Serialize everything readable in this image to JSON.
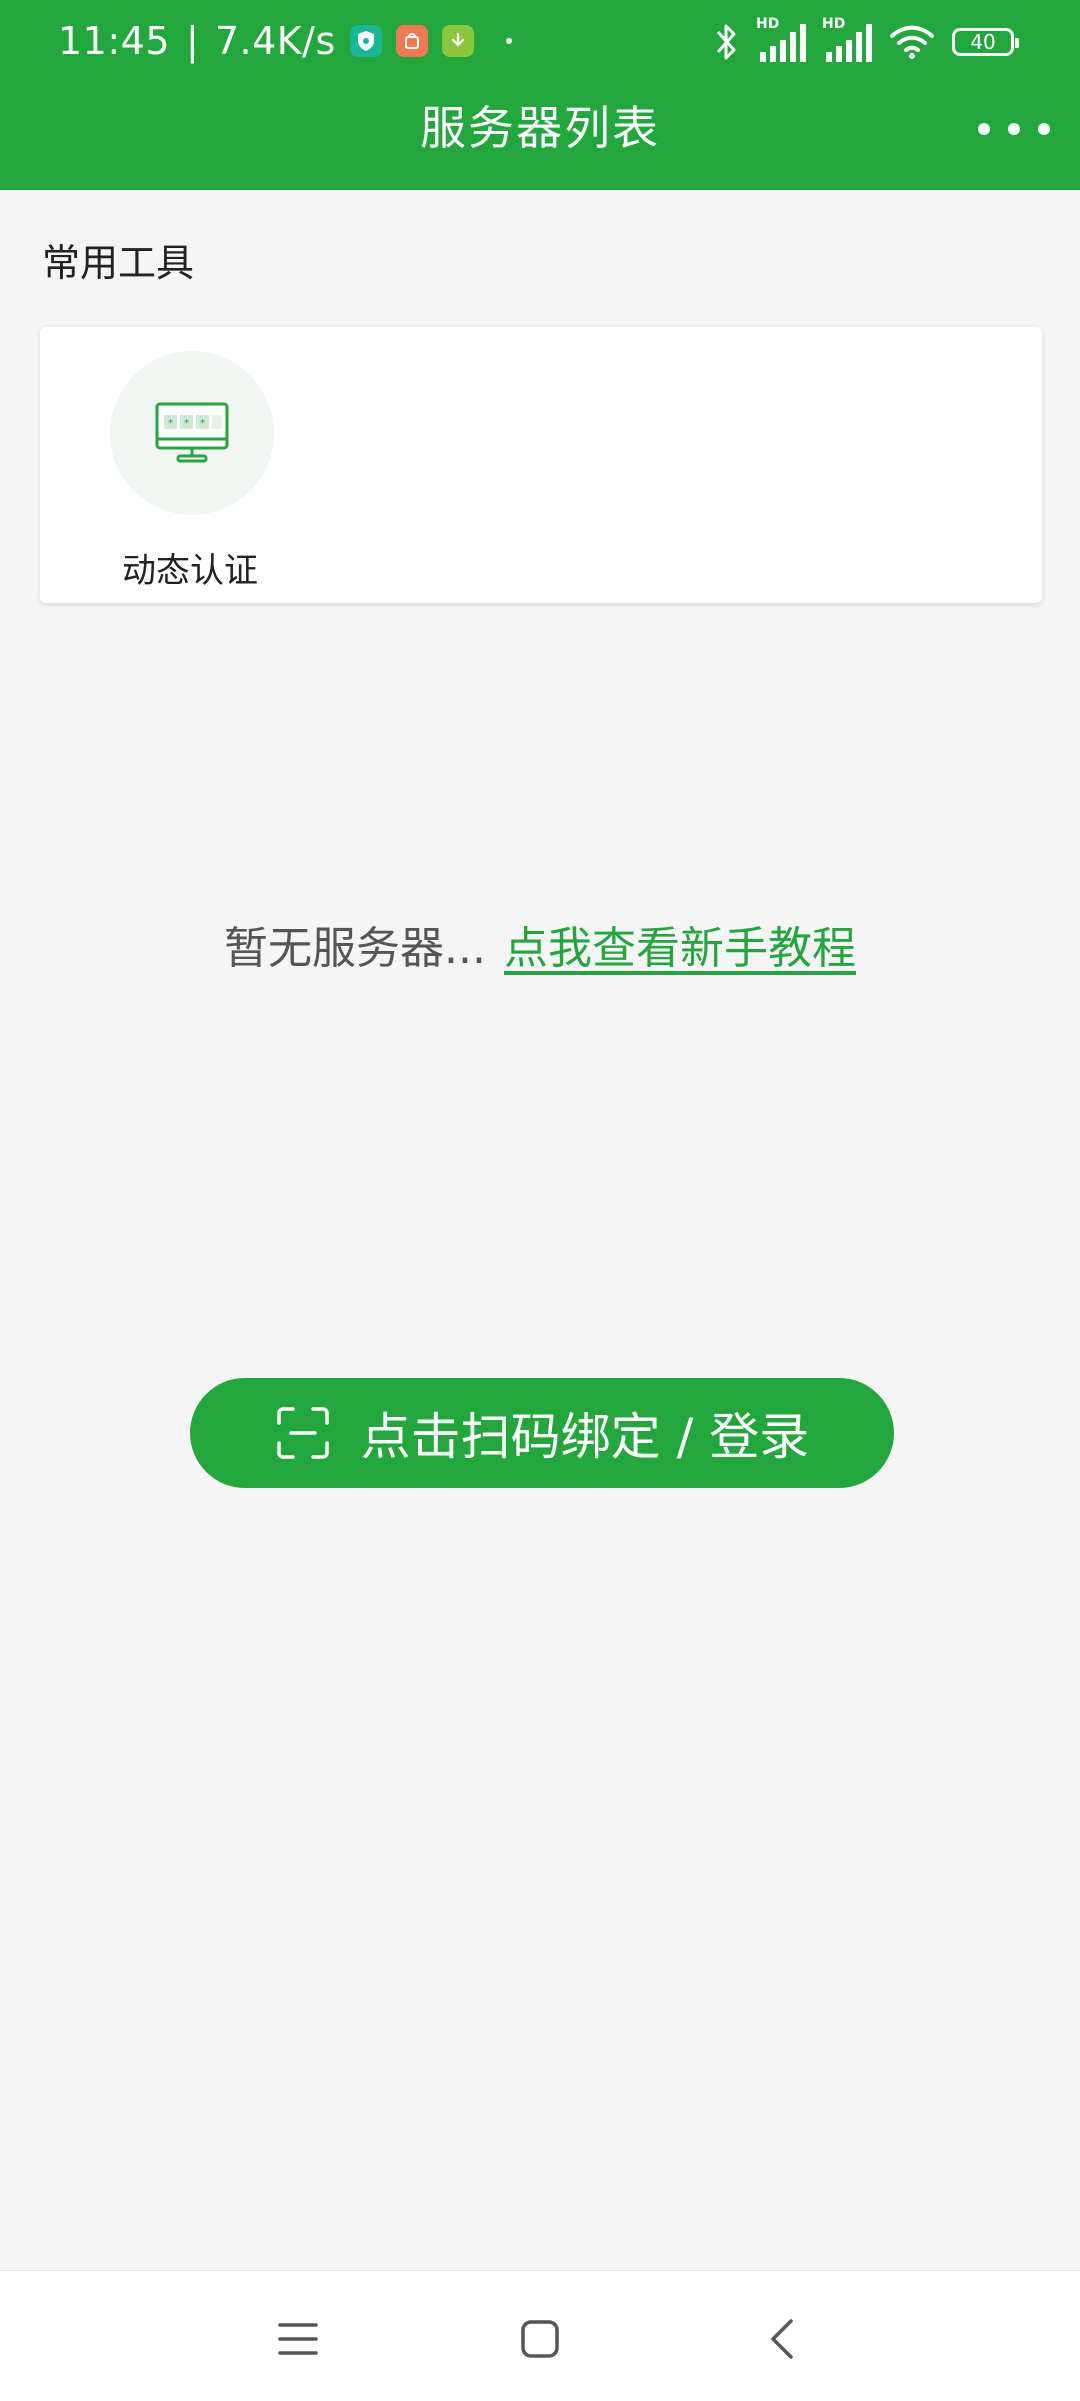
{
  "status_bar": {
    "time": "11:45",
    "separator": "|",
    "net_speed": "7.4K/s",
    "battery": "40",
    "signal_label_1": "HD",
    "signal_label_2": "HD"
  },
  "header": {
    "title": "服务器列表"
  },
  "tools": {
    "section_title": "常用工具",
    "items": [
      {
        "label": "动态认证",
        "icon": "monitor-icon"
      }
    ]
  },
  "empty_state": {
    "message": "暂无服务器...",
    "link_label": "点我查看新手教程"
  },
  "scan_button": {
    "label": "点击扫码绑定 / 登录"
  },
  "colors": {
    "brand": "#22a73c",
    "background": "#f5f5f5"
  }
}
